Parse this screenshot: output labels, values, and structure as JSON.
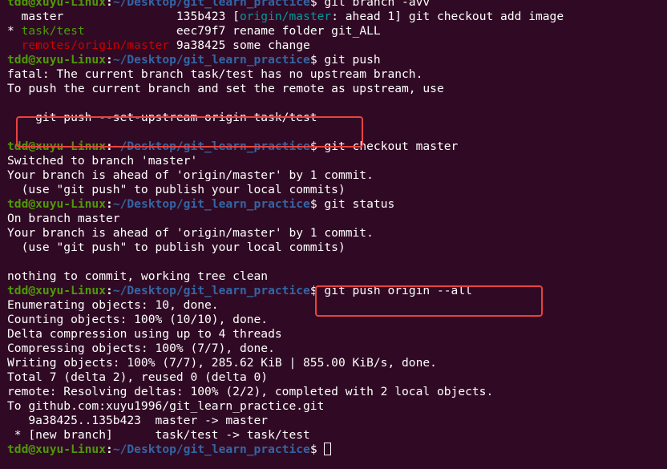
{
  "prompt": {
    "user": "tdd@xuyu-Linux",
    "colon": ":",
    "path": "~/Desktop/git_learn_practice",
    "symbol": "$ "
  },
  "lines": [
    {
      "type": "prompt",
      "cmd": "git branch -avv"
    },
    {
      "type": "segments",
      "segs": [
        {
          "t": "  master                135b423 [",
          "c": ""
        },
        {
          "t": "origin/master",
          "c": "cyan"
        },
        {
          "t": ": ahead 1] git checkout add image",
          "c": ""
        }
      ]
    },
    {
      "type": "segments",
      "segs": [
        {
          "t": "* ",
          "c": ""
        },
        {
          "t": "task/test",
          "c": "green"
        },
        {
          "t": "             eec79f7 rename folder git_ALL",
          "c": ""
        }
      ]
    },
    {
      "type": "segments",
      "segs": [
        {
          "t": "  ",
          "c": ""
        },
        {
          "t": "remotes/origin/master",
          "c": "red"
        },
        {
          "t": " 9a38425 some change",
          "c": ""
        }
      ]
    },
    {
      "type": "prompt",
      "cmd": "git push"
    },
    {
      "type": "text",
      "text": "fatal: The current branch task/test has no upstream branch."
    },
    {
      "type": "text",
      "text": "To push the current branch and set the remote as upstream, use"
    },
    {
      "type": "text",
      "text": ""
    },
    {
      "type": "text",
      "text": "    git push --set-upstream origin task/test"
    },
    {
      "type": "text",
      "text": ""
    },
    {
      "type": "prompt",
      "cmd": "git checkout master"
    },
    {
      "type": "text",
      "text": "Switched to branch 'master'"
    },
    {
      "type": "text",
      "text": "Your branch is ahead of 'origin/master' by 1 commit."
    },
    {
      "type": "text",
      "text": "  (use \"git push\" to publish your local commits)"
    },
    {
      "type": "prompt",
      "cmd": "git status"
    },
    {
      "type": "text",
      "text": "On branch master"
    },
    {
      "type": "text",
      "text": "Your branch is ahead of 'origin/master' by 1 commit."
    },
    {
      "type": "text",
      "text": "  (use \"git push\" to publish your local commits)"
    },
    {
      "type": "text",
      "text": ""
    },
    {
      "type": "text",
      "text": "nothing to commit, working tree clean"
    },
    {
      "type": "prompt",
      "cmd": "git push origin --all"
    },
    {
      "type": "text",
      "text": "Enumerating objects: 10, done."
    },
    {
      "type": "text",
      "text": "Counting objects: 100% (10/10), done."
    },
    {
      "type": "text",
      "text": "Delta compression using up to 4 threads"
    },
    {
      "type": "text",
      "text": "Compressing objects: 100% (7/7), done."
    },
    {
      "type": "text",
      "text": "Writing objects: 100% (7/7), 285.62 KiB | 855.00 KiB/s, done."
    },
    {
      "type": "text",
      "text": "Total 7 (delta 2), reused 0 (delta 0)"
    },
    {
      "type": "text",
      "text": "remote: Resolving deltas: 100% (2/2), completed with 2 local objects."
    },
    {
      "type": "text",
      "text": "To github.com:xuyu1996/git_learn_practice.git"
    },
    {
      "type": "text",
      "text": "   9a38425..135b423  master -> master"
    },
    {
      "type": "text",
      "text": " * [new branch]      task/test -> task/test"
    },
    {
      "type": "prompt",
      "cmd": "",
      "cursor": true
    }
  ],
  "colors": {
    "background": "#300a24",
    "prompt_user": "#4e9a06",
    "prompt_path": "#3465a4",
    "highlight_box": "#e8423f"
  }
}
